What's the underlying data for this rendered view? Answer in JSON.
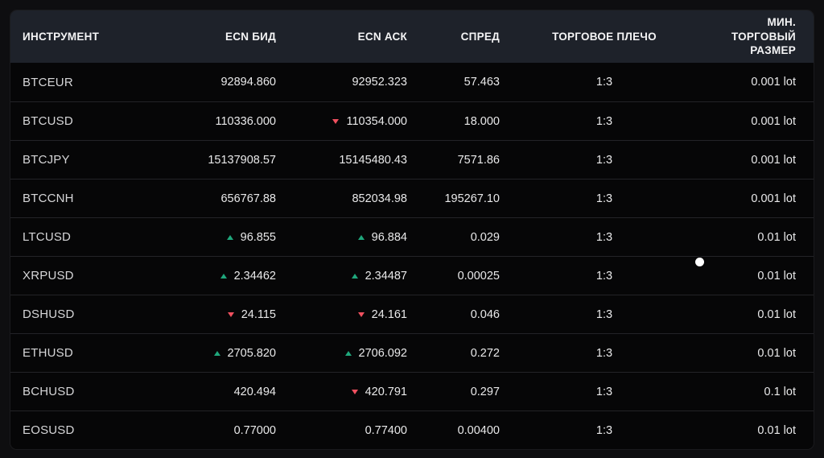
{
  "colors": {
    "up": "#1fa77c",
    "down": "#f0505f",
    "header_bg": "#1e222a",
    "row_bg": "#060607",
    "page_bg": "#0e0e10"
  },
  "table": {
    "columns": [
      {
        "id": "instrument",
        "label": "ИНСТРУМЕНТ"
      },
      {
        "id": "bid",
        "label": "ECN БИД"
      },
      {
        "id": "ask",
        "label": "ECN АСК"
      },
      {
        "id": "spread",
        "label": "СПРЕД"
      },
      {
        "id": "leverage",
        "label": "ТОРГОВОЕ ПЛЕЧО"
      },
      {
        "id": "min_size",
        "label": "МИН. ТОРГОВЫЙ РАЗМЕР"
      }
    ],
    "rows": [
      {
        "symbol": "BTCEUR",
        "bid": "92894.860",
        "bid_dir": "",
        "ask": "92952.323",
        "ask_dir": "",
        "spread": "57.463",
        "leverage": "1:3",
        "min_size": "0.001 lot"
      },
      {
        "symbol": "BTCUSD",
        "bid": "110336.000",
        "bid_dir": "",
        "ask": "110354.000",
        "ask_dir": "down",
        "spread": "18.000",
        "leverage": "1:3",
        "min_size": "0.001 lot"
      },
      {
        "symbol": "BTCJPY",
        "bid": "15137908.57",
        "bid_dir": "",
        "ask": "15145480.43",
        "ask_dir": "",
        "spread": "7571.86",
        "leverage": "1:3",
        "min_size": "0.001 lot"
      },
      {
        "symbol": "BTCCNH",
        "bid": "656767.88",
        "bid_dir": "",
        "ask": "852034.98",
        "ask_dir": "",
        "spread": "195267.10",
        "leverage": "1:3",
        "min_size": "0.001 lot"
      },
      {
        "symbol": "LTCUSD",
        "bid": "96.855",
        "bid_dir": "up",
        "ask": "96.884",
        "ask_dir": "up",
        "spread": "0.029",
        "leverage": "1:3",
        "min_size": "0.01 lot"
      },
      {
        "symbol": "XRPUSD",
        "bid": "2.34462",
        "bid_dir": "up",
        "ask": "2.34487",
        "ask_dir": "up",
        "spread": "0.00025",
        "leverage": "1:3",
        "min_size": "0.01 lot"
      },
      {
        "symbol": "DSHUSD",
        "bid": "24.115",
        "bid_dir": "down",
        "ask": "24.161",
        "ask_dir": "down",
        "spread": "0.046",
        "leverage": "1:3",
        "min_size": "0.01 lot"
      },
      {
        "symbol": "ETHUSD",
        "bid": "2705.820",
        "bid_dir": "up",
        "ask": "2706.092",
        "ask_dir": "up",
        "spread": "0.272",
        "leverage": "1:3",
        "min_size": "0.01 lot"
      },
      {
        "symbol": "BCHUSD",
        "bid": "420.494",
        "bid_dir": "",
        "ask": "420.791",
        "ask_dir": "down",
        "spread": "0.297",
        "leverage": "1:3",
        "min_size": "0.1 lot"
      },
      {
        "symbol": "EOSUSD",
        "bid": "0.77000",
        "bid_dir": "",
        "ask": "0.77400",
        "ask_dir": "",
        "spread": "0.00400",
        "leverage": "1:3",
        "min_size": "0.01 lot"
      }
    ]
  }
}
